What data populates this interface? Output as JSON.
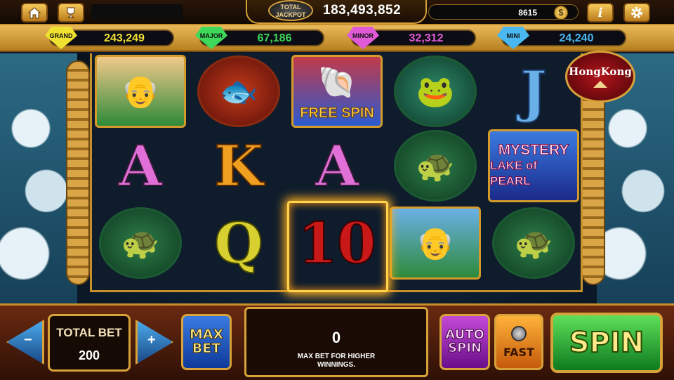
{
  "header": {
    "home_icon": "home-icon",
    "trophy_icon": "trophy-icon",
    "total_jackpot_label": "TOTAL JACKPOT",
    "total_jackpot_value": "183,493,852",
    "balance": "8615",
    "coin_symbol": "$",
    "info_label": "i",
    "settings_icon": "gear-icon"
  },
  "jackpots": [
    {
      "name": "GRAND",
      "value": "243,249",
      "color": "#f0e030"
    },
    {
      "name": "MAJOR",
      "value": "67,186",
      "color": "#3ed85a"
    },
    {
      "name": "MINOR",
      "value": "32,312",
      "color": "#e05ad8"
    },
    {
      "name": "MINI",
      "value": "24,240",
      "color": "#4ab8f0"
    }
  ],
  "reels": {
    "hongkong_badge": "HongKong",
    "free_spin_label": "FREE SPIN",
    "mystery_label_1": "MYSTERY",
    "mystery_label_2": "LAKE of PEARL",
    "letters": {
      "a": "A",
      "k": "K",
      "q": "Q",
      "ten": "10",
      "j": "J"
    }
  },
  "controls": {
    "minus_label": "−",
    "plus_label": "+",
    "total_bet_label": "TOTAL BET",
    "total_bet_value": "200",
    "max_bet_label": "MAX BET",
    "win_value": "0",
    "win_message": "MAX BET FOR HIGHER WINNINGS.",
    "auto_spin_label": "AUTO SPIN",
    "fast_label": "FAST",
    "spin_label": "SPIN"
  }
}
